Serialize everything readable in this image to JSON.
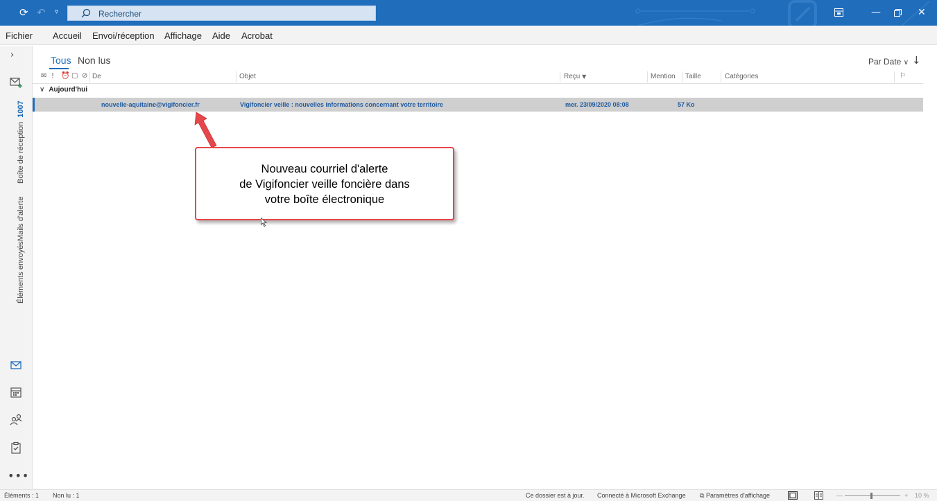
{
  "titlebar": {
    "search_placeholder": "Rechercher",
    "accent_color": "#1f6dbb",
    "icons": [
      "sync-icon",
      "undo-icon",
      "quick-access-dropdown-icon",
      "search-icon",
      "ribbon-display-icon",
      "minimize-icon",
      "restore-icon",
      "close-icon"
    ]
  },
  "menu": {
    "items": [
      "Fichier",
      "Accueil",
      "Envoi/réception",
      "Affichage",
      "Aide",
      "Acrobat"
    ]
  },
  "rail": {
    "inbox_label": "Boîte de réception",
    "inbox_count": "1007",
    "alerts_label": "Mails d'alerte",
    "sent_label": "Éléments envoyés",
    "nav_icons": [
      "mail-icon",
      "calendar-icon",
      "people-icon",
      "tasks-icon",
      "more-icon"
    ]
  },
  "list": {
    "filter_all": "Tous",
    "filter_unread": "Non lus",
    "sort_label": "Par Date",
    "columns": {
      "from": "De",
      "subject": "Objet",
      "received": "Reçu",
      "mention": "Mention",
      "size": "Taille",
      "categories": "Catégories"
    },
    "group_label": "Aujourd'hui",
    "messages": [
      {
        "from": "nouvelle-aquitaine@vigifoncier.fr",
        "subject": "Vigifoncier veille : nouvelles informations concernant votre territoire",
        "received": "mer. 23/09/2020 08:08",
        "size": "57 Ko"
      }
    ]
  },
  "callout": {
    "line1": "Nouveau courriel d'alerte",
    "line2": "de Vigifoncier veille foncière dans",
    "line3": "votre boîte électronique",
    "border_color": "#e5474b"
  },
  "status": {
    "items": "Éléments : 1",
    "unread": "Non lu : 1",
    "folder_status": "Ce dossier est à jour.",
    "connection": "Connecté à Microsoft Exchange",
    "display_settings": "Paramètres d'affichage",
    "zoom": "10 %"
  }
}
